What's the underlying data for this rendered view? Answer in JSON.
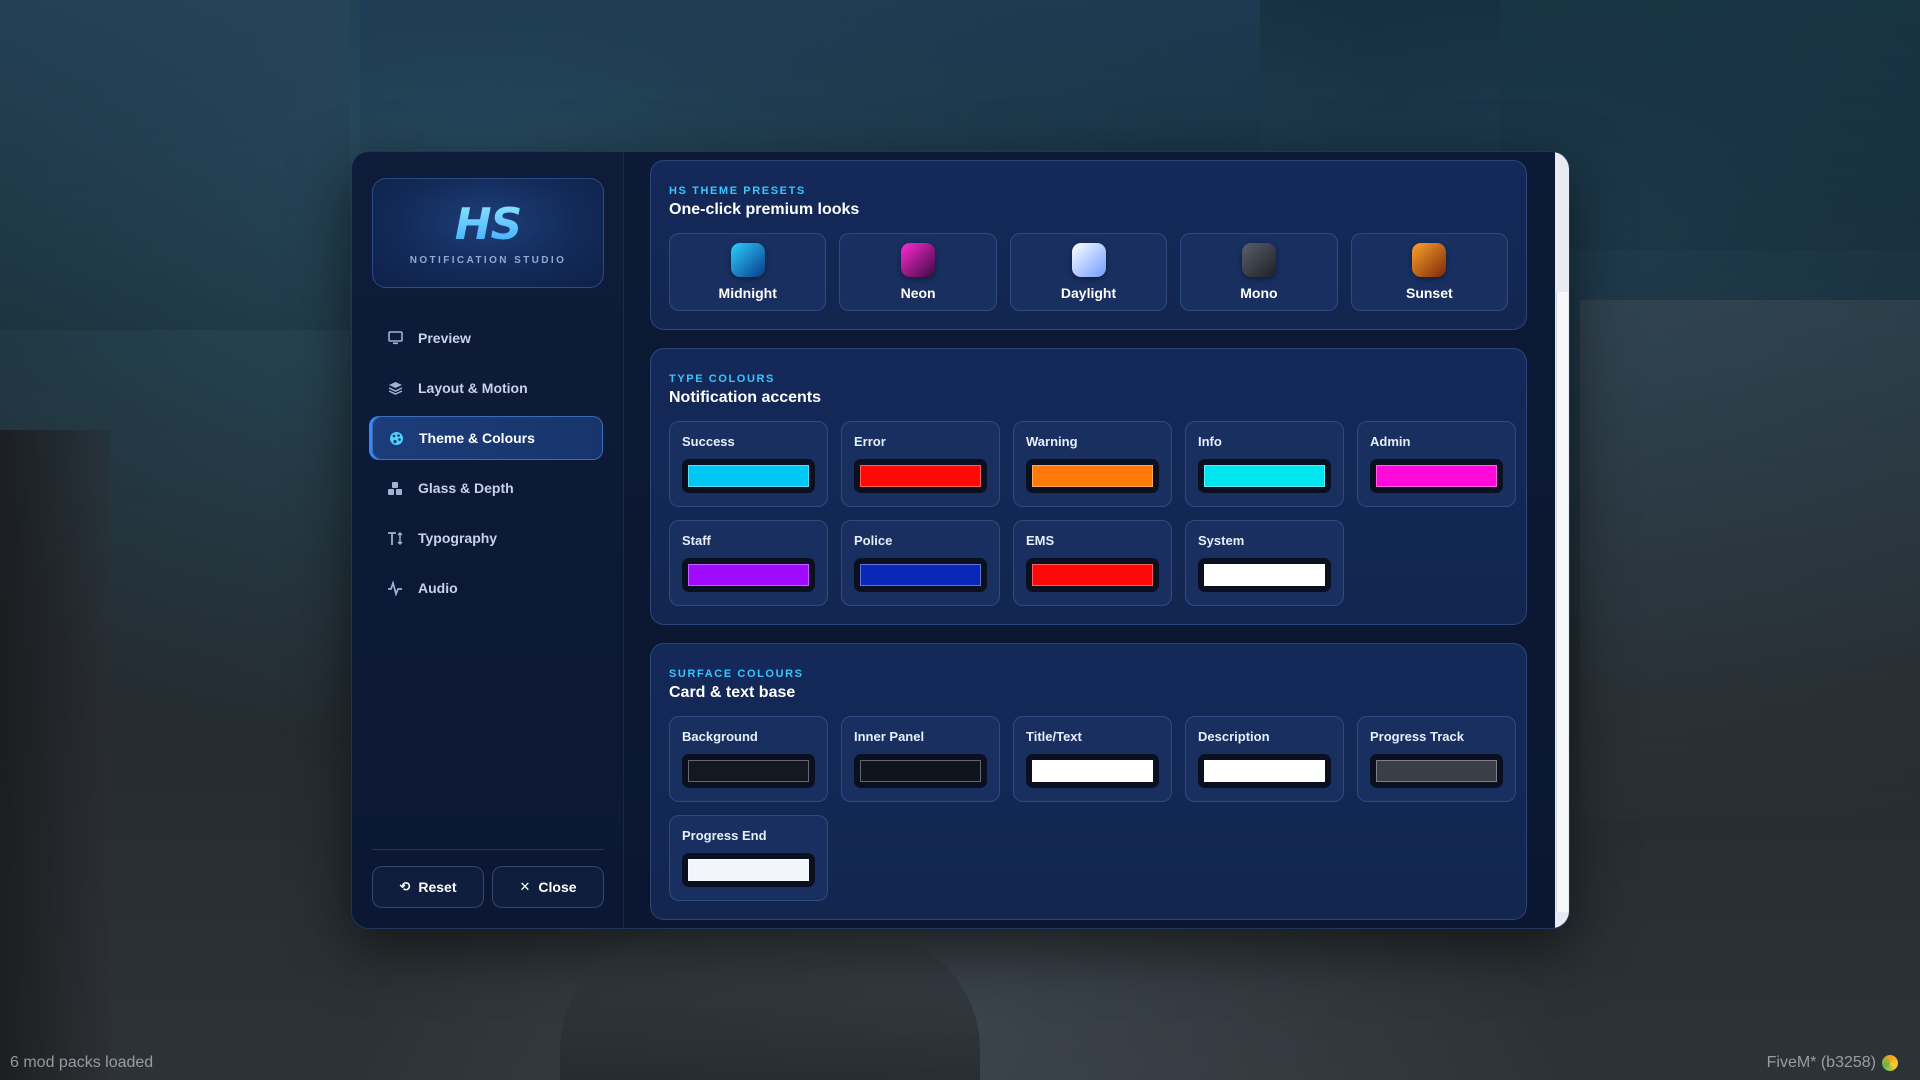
{
  "brand": {
    "logo": "HS",
    "subtitle": "NOTIFICATION STUDIO"
  },
  "sidebar": {
    "items": [
      {
        "label": "Preview",
        "icon": "monitor-icon",
        "active": false
      },
      {
        "label": "Layout & Motion",
        "icon": "layers-icon",
        "active": false
      },
      {
        "label": "Theme & Colours",
        "icon": "palette-icon",
        "active": true
      },
      {
        "label": "Glass & Depth",
        "icon": "cubes-icon",
        "active": false
      },
      {
        "label": "Typography",
        "icon": "text-height-icon",
        "active": false
      },
      {
        "label": "Audio",
        "icon": "waveform-icon",
        "active": false
      }
    ],
    "reset_label": "Reset",
    "close_label": "Close"
  },
  "presets": {
    "eyebrow": "HS THEME PRESETS",
    "heading": "One-click premium looks",
    "items": [
      {
        "label": "Midnight",
        "color_a": "#2ad0ff",
        "color_b": "#0a3a8a"
      },
      {
        "label": "Neon",
        "color_a": "#ff2ad4",
        "color_b": "#3a0a40"
      },
      {
        "label": "Daylight",
        "color_a": "#ffffff",
        "color_b": "#6e9cff"
      },
      {
        "label": "Mono",
        "color_a": "#5a5f6a",
        "color_b": "#1d2027"
      },
      {
        "label": "Sunset",
        "color_a": "#ffa12a",
        "color_b": "#7a2a0a"
      }
    ]
  },
  "type_colours": {
    "eyebrow": "TYPE COLOURS",
    "heading": "Notification accents",
    "items": [
      {
        "label": "Success",
        "color": "#00c8f5"
      },
      {
        "label": "Error",
        "color": "#ff0808"
      },
      {
        "label": "Warning",
        "color": "#ff7a0a"
      },
      {
        "label": "Info",
        "color": "#00e6f0"
      },
      {
        "label": "Admin",
        "color": "#ff0ad8"
      },
      {
        "label": "Staff",
        "color": "#a00aff"
      },
      {
        "label": "Police",
        "color": "#0a28b8"
      },
      {
        "label": "EMS",
        "color": "#ff0808"
      },
      {
        "label": "System",
        "color": "#ffffff"
      }
    ]
  },
  "surface_colours": {
    "eyebrow": "SURFACE COLOURS",
    "heading": "Card & text base",
    "items": [
      {
        "label": "Background",
        "color": "#141820"
      },
      {
        "label": "Inner Panel",
        "color": "#10141c"
      },
      {
        "label": "Title/Text",
        "color": "#ffffff"
      },
      {
        "label": "Description",
        "color": "#ffffff"
      },
      {
        "label": "Progress Track",
        "color": "#3a3e46"
      },
      {
        "label": "Progress End",
        "color": "#f2f5fa"
      }
    ]
  },
  "hud": {
    "left": "6 mod packs loaded",
    "right": "FiveM* (b3258)"
  }
}
